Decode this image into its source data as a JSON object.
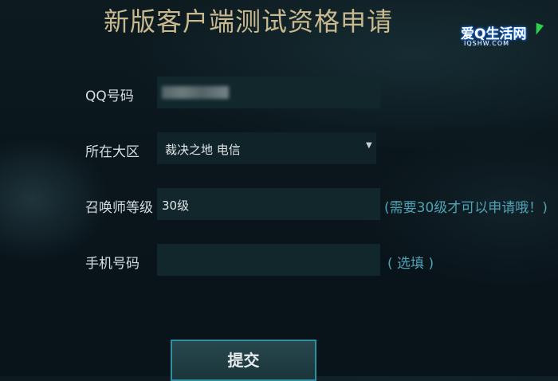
{
  "title": "新版客户端测试资格申请",
  "logo": {
    "text": "爱Q生活网",
    "subtext": "IQSHW.COM"
  },
  "form": {
    "qq": {
      "label": "QQ号码",
      "value_hidden": true
    },
    "region": {
      "label": "所在大区",
      "value": "裁决之地 电信",
      "arrow": "▼"
    },
    "level": {
      "label": "召唤师等级",
      "value": "30级",
      "hint": "(需要30级才可以申请哦！)"
    },
    "phone": {
      "label": "手机号码",
      "value": "",
      "hint": "( 选填 )"
    },
    "submit_label": "提交"
  },
  "colors": {
    "title": "#c9b98f",
    "label": "#d7dde0",
    "hint": "#4fa3b6",
    "field_bg": "#11272c",
    "button_border": "#2f8fa0"
  }
}
